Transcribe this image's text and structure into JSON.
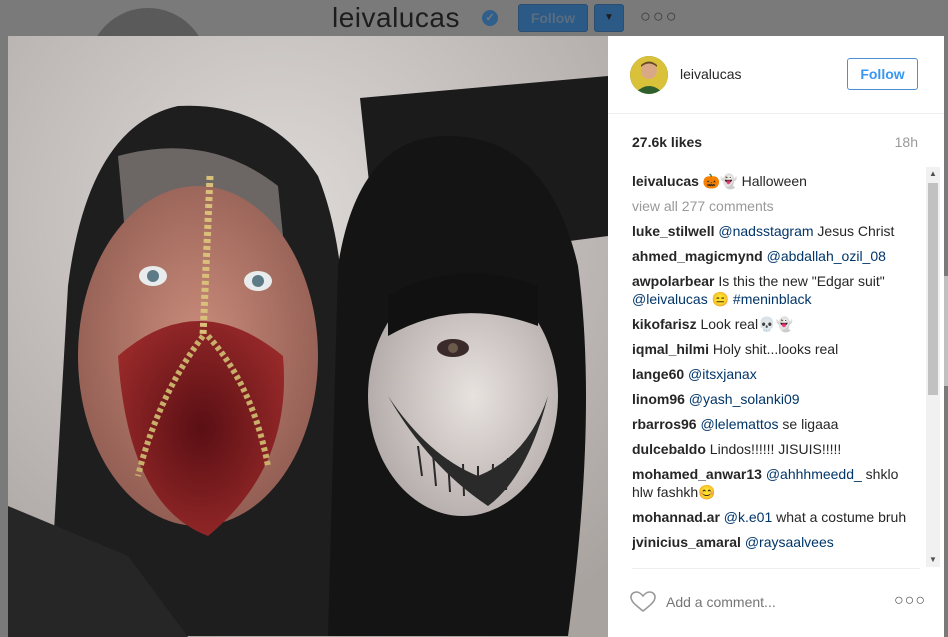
{
  "background_profile": {
    "username": "leivalucas",
    "follow_label": "Follow",
    "dropdown_glyph": "▼",
    "more_glyph": "○○○"
  },
  "post": {
    "author": "leivalucas",
    "follow_label": "Follow",
    "likes": "27.6k likes",
    "time": "18h",
    "caption": {
      "user": "leivalucas",
      "text": "🎃👻 Halloween"
    },
    "view_all": "view all 277 comments",
    "comments": [
      {
        "user": "luke_stilwell",
        "link": "@nadsstagram",
        "text": " Jesus Christ"
      },
      {
        "user": "ahmed_magicmynd",
        "link": "@abdallah_ozil_08",
        "text": ""
      },
      {
        "user": "awpolarbear",
        "link": "",
        "text": " Is this the new \"Edgar suit\" ",
        "link2": "@leivalucas",
        "text2": " 😑 ",
        "link3": "#meninblack"
      },
      {
        "user": "kikofarisz",
        "link": "",
        "text": " Look real💀👻"
      },
      {
        "user": "iqmal_hilmi",
        "link": "",
        "text": " Holy shit...looks real"
      },
      {
        "user": "lange60",
        "link": "@itsxjanax",
        "text": ""
      },
      {
        "user": "linom96",
        "link": "@yash_solanki09",
        "text": ""
      },
      {
        "user": "rbarros96",
        "link": "@lelemattos",
        "text": " se ligaaa"
      },
      {
        "user": "dulcebaldo",
        "link": "",
        "text": " Lindos!!!!!! JISUIS!!!!!"
      },
      {
        "user": "mohamed_anwar13",
        "link": "@ahhhmeedd_",
        "text": " shklo hlw fashkh😊"
      },
      {
        "user": "mohannad.ar",
        "link": "@k.e01",
        "text": " what a costume bruh"
      },
      {
        "user": "jvinicius_amaral",
        "link": "@raysaalvees",
        "text": ""
      }
    ],
    "add_comment_placeholder": "Add a comment...",
    "more_options": "○○○"
  },
  "icons": {
    "heart": "heart-icon",
    "verified": "verified-badge-icon"
  },
  "colors": {
    "follow_blue": "#3897f0",
    "link_blue": "#003569",
    "muted": "#999999",
    "text": "#262626"
  }
}
